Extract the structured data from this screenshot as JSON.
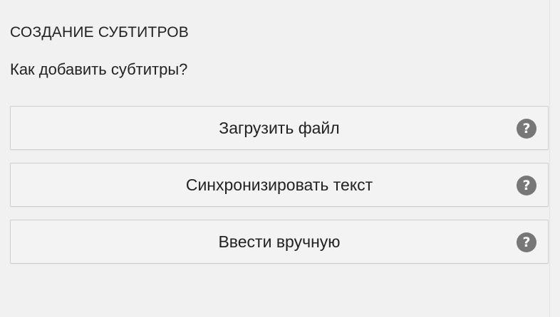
{
  "panel": {
    "title": "СОЗДАНИЕ СУБТИТРОВ",
    "question": "Как добавить субтитры?"
  },
  "options": [
    {
      "label": "Загрузить файл",
      "help_icon": "question-circle-icon",
      "help_glyph": "?"
    },
    {
      "label": "Синхронизировать текст",
      "help_icon": "question-circle-icon",
      "help_glyph": "?"
    },
    {
      "label": "Ввести вручную",
      "help_icon": "question-circle-icon",
      "help_glyph": "?"
    }
  ],
  "colors": {
    "background": "#f1f1f1",
    "button_background": "#f3f3f3",
    "button_border": "#cfcfcf",
    "help_icon": "#777777",
    "text": "#222222"
  }
}
